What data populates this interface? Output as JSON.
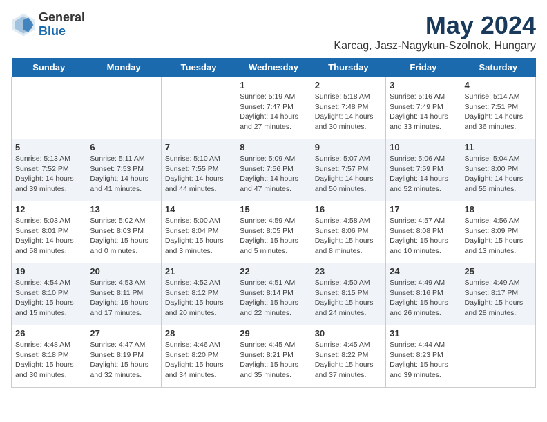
{
  "logo": {
    "general": "General",
    "blue": "Blue"
  },
  "title": "May 2024",
  "location": "Karcag, Jasz-Nagykun-Szolnok, Hungary",
  "headers": [
    "Sunday",
    "Monday",
    "Tuesday",
    "Wednesday",
    "Thursday",
    "Friday",
    "Saturday"
  ],
  "rows": [
    [
      {
        "date": "",
        "info": ""
      },
      {
        "date": "",
        "info": ""
      },
      {
        "date": "",
        "info": ""
      },
      {
        "date": "1",
        "info": "Sunrise: 5:19 AM\nSunset: 7:47 PM\nDaylight: 14 hours and 27 minutes."
      },
      {
        "date": "2",
        "info": "Sunrise: 5:18 AM\nSunset: 7:48 PM\nDaylight: 14 hours and 30 minutes."
      },
      {
        "date": "3",
        "info": "Sunrise: 5:16 AM\nSunset: 7:49 PM\nDaylight: 14 hours and 33 minutes."
      },
      {
        "date": "4",
        "info": "Sunrise: 5:14 AM\nSunset: 7:51 PM\nDaylight: 14 hours and 36 minutes."
      }
    ],
    [
      {
        "date": "5",
        "info": "Sunrise: 5:13 AM\nSunset: 7:52 PM\nDaylight: 14 hours and 39 minutes."
      },
      {
        "date": "6",
        "info": "Sunrise: 5:11 AM\nSunset: 7:53 PM\nDaylight: 14 hours and 41 minutes."
      },
      {
        "date": "7",
        "info": "Sunrise: 5:10 AM\nSunset: 7:55 PM\nDaylight: 14 hours and 44 minutes."
      },
      {
        "date": "8",
        "info": "Sunrise: 5:09 AM\nSunset: 7:56 PM\nDaylight: 14 hours and 47 minutes."
      },
      {
        "date": "9",
        "info": "Sunrise: 5:07 AM\nSunset: 7:57 PM\nDaylight: 14 hours and 50 minutes."
      },
      {
        "date": "10",
        "info": "Sunrise: 5:06 AM\nSunset: 7:59 PM\nDaylight: 14 hours and 52 minutes."
      },
      {
        "date": "11",
        "info": "Sunrise: 5:04 AM\nSunset: 8:00 PM\nDaylight: 14 hours and 55 minutes."
      }
    ],
    [
      {
        "date": "12",
        "info": "Sunrise: 5:03 AM\nSunset: 8:01 PM\nDaylight: 14 hours and 58 minutes."
      },
      {
        "date": "13",
        "info": "Sunrise: 5:02 AM\nSunset: 8:03 PM\nDaylight: 15 hours and 0 minutes."
      },
      {
        "date": "14",
        "info": "Sunrise: 5:00 AM\nSunset: 8:04 PM\nDaylight: 15 hours and 3 minutes."
      },
      {
        "date": "15",
        "info": "Sunrise: 4:59 AM\nSunset: 8:05 PM\nDaylight: 15 hours and 5 minutes."
      },
      {
        "date": "16",
        "info": "Sunrise: 4:58 AM\nSunset: 8:06 PM\nDaylight: 15 hours and 8 minutes."
      },
      {
        "date": "17",
        "info": "Sunrise: 4:57 AM\nSunset: 8:08 PM\nDaylight: 15 hours and 10 minutes."
      },
      {
        "date": "18",
        "info": "Sunrise: 4:56 AM\nSunset: 8:09 PM\nDaylight: 15 hours and 13 minutes."
      }
    ],
    [
      {
        "date": "19",
        "info": "Sunrise: 4:54 AM\nSunset: 8:10 PM\nDaylight: 15 hours and 15 minutes."
      },
      {
        "date": "20",
        "info": "Sunrise: 4:53 AM\nSunset: 8:11 PM\nDaylight: 15 hours and 17 minutes."
      },
      {
        "date": "21",
        "info": "Sunrise: 4:52 AM\nSunset: 8:12 PM\nDaylight: 15 hours and 20 minutes."
      },
      {
        "date": "22",
        "info": "Sunrise: 4:51 AM\nSunset: 8:14 PM\nDaylight: 15 hours and 22 minutes."
      },
      {
        "date": "23",
        "info": "Sunrise: 4:50 AM\nSunset: 8:15 PM\nDaylight: 15 hours and 24 minutes."
      },
      {
        "date": "24",
        "info": "Sunrise: 4:49 AM\nSunset: 8:16 PM\nDaylight: 15 hours and 26 minutes."
      },
      {
        "date": "25",
        "info": "Sunrise: 4:49 AM\nSunset: 8:17 PM\nDaylight: 15 hours and 28 minutes."
      }
    ],
    [
      {
        "date": "26",
        "info": "Sunrise: 4:48 AM\nSunset: 8:18 PM\nDaylight: 15 hours and 30 minutes."
      },
      {
        "date": "27",
        "info": "Sunrise: 4:47 AM\nSunset: 8:19 PM\nDaylight: 15 hours and 32 minutes."
      },
      {
        "date": "28",
        "info": "Sunrise: 4:46 AM\nSunset: 8:20 PM\nDaylight: 15 hours and 34 minutes."
      },
      {
        "date": "29",
        "info": "Sunrise: 4:45 AM\nSunset: 8:21 PM\nDaylight: 15 hours and 35 minutes."
      },
      {
        "date": "30",
        "info": "Sunrise: 4:45 AM\nSunset: 8:22 PM\nDaylight: 15 hours and 37 minutes."
      },
      {
        "date": "31",
        "info": "Sunrise: 4:44 AM\nSunset: 8:23 PM\nDaylight: 15 hours and 39 minutes."
      },
      {
        "date": "",
        "info": ""
      }
    ]
  ]
}
